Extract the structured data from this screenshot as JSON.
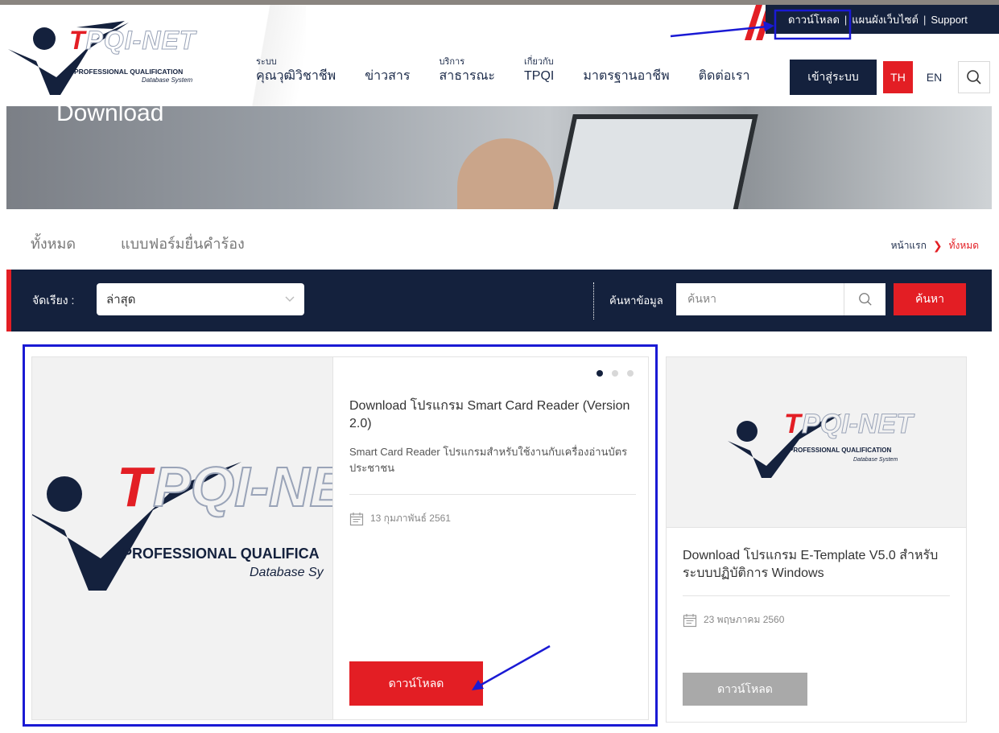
{
  "top_links": {
    "download": "ดาวน์โหลด",
    "sitemap": "แผนผังเว็บไซต์",
    "support": "Support",
    "separator": "|"
  },
  "logo": {
    "brand": "TPQI-NET",
    "line1": "PROFESSIONAL QUALIFICATION",
    "line2": "Database System"
  },
  "nav": {
    "items": [
      {
        "small": "ระบบ",
        "label": "คุณวุฒิวิชาชีพ"
      },
      {
        "small": "",
        "label": "ข่าวสาร"
      },
      {
        "small": "บริการ",
        "label": "สาธารณะ"
      },
      {
        "small": "เกี่ยวกับ",
        "label": "TPQI"
      },
      {
        "small": "",
        "label": "มาตรฐานอาชีพ"
      },
      {
        "small": "",
        "label": "ติดต่อเรา"
      }
    ],
    "login": "เข้าสู่ระบบ",
    "lang_th": "TH",
    "lang_en": "EN"
  },
  "hero": {
    "title": "Download"
  },
  "tabs": {
    "all": "ทั้งหมด",
    "forms": "แบบฟอร์มยื่นคำร้อง"
  },
  "breadcrumb": {
    "home": "หน้าแรก",
    "separator": "❯",
    "current": "ทั้งหมด"
  },
  "filter": {
    "sort_label": "จัดเรียง :",
    "sort_value": "ล่าสุด",
    "search_label": "ค้นหาข้อมูล",
    "search_placeholder": "ค้นหา",
    "search_button": "ค้นหา"
  },
  "cards": [
    {
      "title": "Download โปรแกรม Smart Card Reader (Version 2.0)",
      "description": "Smart Card Reader โปรแกรมสำหรับใช้งานกับเครื่องอ่านบัตรประชาชน",
      "date": "13 กุมภาพันธ์ 2561",
      "button": "ดาวน์โหลด",
      "slides": 3,
      "active_slide": 1
    },
    {
      "title": "Download โปรแกรม E-Template V5.0 สำหรับระบบปฏิบัติการ Windows",
      "date": "23 พฤษภาคม 2560",
      "button": "ดาวน์โหลด"
    }
  ],
  "colors": {
    "navy": "#14213d",
    "red": "#e31e24",
    "annotation_blue": "#1a1ad4",
    "button_grey": "#a9a9a9"
  },
  "icons": [
    "search-icon",
    "chevron-down-icon",
    "calendar-icon",
    "chevron-right-icon",
    "arrow-annotation"
  ]
}
